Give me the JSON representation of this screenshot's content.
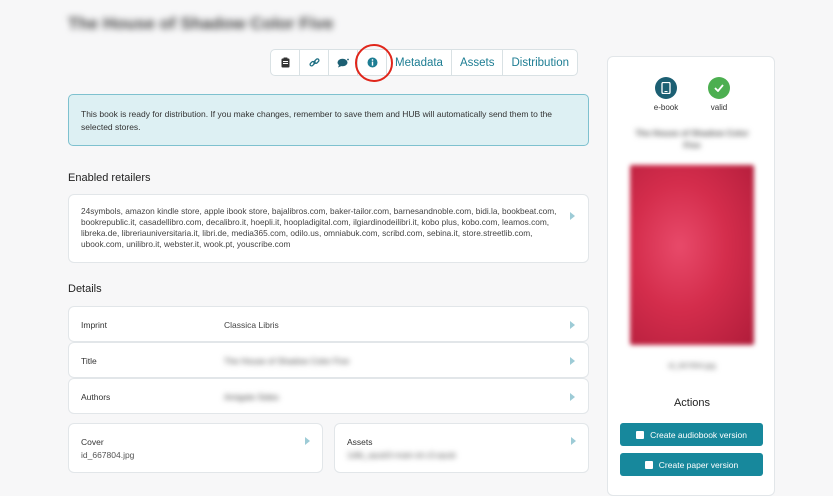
{
  "page": {
    "title": "The House of Shadow Color Five"
  },
  "toolbar": {
    "icons": [
      "clipboard-icon",
      "link-icon",
      "comment-icon",
      "info-icon"
    ],
    "tabs": [
      "Metadata",
      "Assets",
      "Distribution"
    ]
  },
  "info": {
    "message": "This book is ready for distribution. If you make changes, remember to save them and HUB will automatically send them to the selected stores."
  },
  "retailers": {
    "heading": "Enabled retailers",
    "list": "24symbols, amazon kindle store, apple ibook store, bajalibros.com, baker-tailor.com, barnesandnoble.com, bidi.la, bookbeat.com, bookrepublic.it, casadellibro.com, decalibro.it, hoepli.it, hoopladigital.com, ilgiardinodeilibri.it, kobo plus, kobo.com, leamos.com, libreka.de, libreriauniversitaria.it, libri.de, media365.com, odilo.us, omniabuk.com, scribd.com, sebina.it, store.streetlib.com, ubook.com, unilibro.it, webster.it, wook.pt, youscribe.com"
  },
  "details": {
    "heading": "Details",
    "rows": [
      {
        "label": "Imprint",
        "value": "Classica Libris"
      },
      {
        "label": "Title",
        "value": "The House of Shadow Color Five"
      },
      {
        "label": "Authors",
        "value": "Amigate Sides"
      }
    ],
    "cover": {
      "label": "Cover",
      "value": "id_667804.jpg"
    },
    "assets": {
      "label": "Assets",
      "value": "1dtb_epub3-main-id-c3.epub"
    }
  },
  "side": {
    "format_label": "e-book",
    "status_label": "valid",
    "book_title": "The House of Shadow Color Five",
    "cover_caption": "id_667804.jpg",
    "actions_heading": "Actions",
    "actions": [
      "Create audiobook version",
      "Create paper version"
    ],
    "colors": {
      "accent": "#17889c",
      "valid": "#4caf50",
      "format": "#1c5f73"
    }
  }
}
